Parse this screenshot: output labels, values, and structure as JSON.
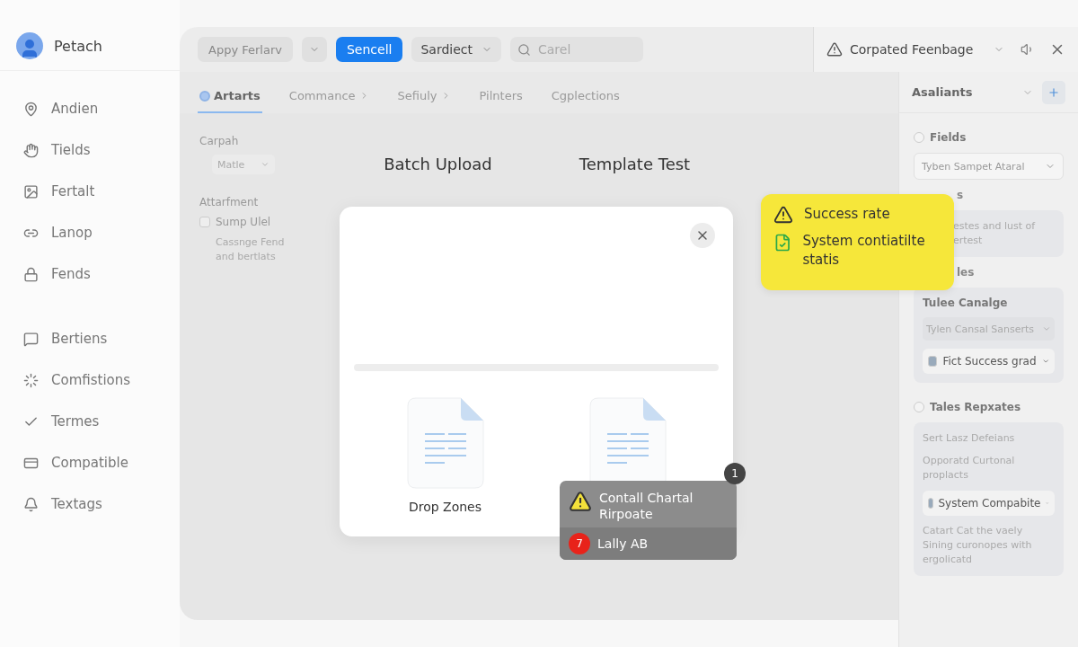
{
  "sidebar": {
    "user": {
      "name": "Petach"
    },
    "groups": [
      [
        {
          "label": "Andien"
        },
        {
          "label": "Tields"
        },
        {
          "label": "Fertalt"
        },
        {
          "label": "Lanop"
        },
        {
          "label": "Fends"
        }
      ],
      [
        {
          "label": "Bertiens"
        },
        {
          "label": "Comfistions"
        },
        {
          "label": "Termes"
        },
        {
          "label": "Compatible"
        },
        {
          "label": "Textags"
        }
      ]
    ]
  },
  "toolbar": {
    "apply_button": "Appy Ferlarv",
    "primary_button": "Sencell",
    "dropdown": "Sardiect",
    "search": {
      "placeholder": "Carel"
    }
  },
  "notice": {
    "label": "Corpated Feenbage"
  },
  "tabs": [
    {
      "label": "Artarts",
      "selected": true,
      "chevron": false
    },
    {
      "label": "Commance",
      "selected": false,
      "chevron": true
    },
    {
      "label": "Sefiuly",
      "selected": false,
      "chevron": true
    },
    {
      "label": "Pilnters",
      "selected": false,
      "chevron": false
    },
    {
      "label": "Cgplections",
      "selected": false,
      "chevron": false
    }
  ],
  "form": {
    "section_1": {
      "label": "Carpah",
      "select": "Matle"
    },
    "section_2": {
      "label": "Attarfment",
      "checkbox": {
        "label": "Sump Ulel",
        "checked": false
      },
      "note": "Cassnge Fend and bertlats"
    }
  },
  "headings": [
    "Batch Upload",
    "Template Test"
  ],
  "modal": {
    "files": [
      {
        "kind": "labeled",
        "label": "Drop Zones"
      },
      {
        "kind": "plain"
      }
    ]
  },
  "toast": {
    "count": "1",
    "message": "Contall Chartal Rirpoate",
    "user_badge": "7",
    "user": "Lally AB"
  },
  "popup": {
    "items": [
      {
        "kind": "warning",
        "text": "Success rate"
      },
      {
        "kind": "check",
        "text": "System contiatilte statis"
      }
    ]
  },
  "panel": {
    "title": "Asaliants",
    "blocks": [
      {
        "kind": "radio_heading",
        "text": "Fields",
        "checked": false
      },
      {
        "kind": "select",
        "text": "Tyben Sampet Ataral"
      },
      {
        "kind": "partial_heading",
        "text": "s"
      },
      {
        "kind": "card",
        "items": [
          {
            "kind": "partial_text",
            "text": "estes and lust of ertest"
          }
        ]
      },
      {
        "kind": "partial_heading",
        "text": "les"
      },
      {
        "kind": "card",
        "items": [
          {
            "kind": "title",
            "text": "Tulee Canalge"
          },
          {
            "kind": "select",
            "text": "Tylen Cansal Sanserts"
          },
          {
            "kind": "check_select",
            "text": "Fict Success grad",
            "checked": true
          }
        ]
      },
      {
        "kind": "radio_heading",
        "text": "Tales Repxates",
        "checked": false
      },
      {
        "kind": "card",
        "items": [
          {
            "kind": "text",
            "text": "Sert Lasz Defeians"
          },
          {
            "kind": "text",
            "text": "Opporatd Curtonal proplacts"
          },
          {
            "kind": "check_select",
            "text": "System Compabite",
            "checked": true
          },
          {
            "kind": "text",
            "text": "Catart Cat the vaely Sining curonopes with ergolicatd"
          }
        ]
      }
    ]
  }
}
